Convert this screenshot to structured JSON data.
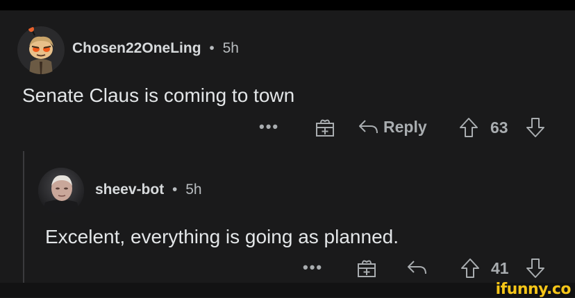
{
  "comment": {
    "username": "Chosen22OneLing",
    "separator": "•",
    "age": "5h",
    "text": "Senate Claus is coming to town",
    "actions": {
      "more_label": "•••",
      "reply_label": "Reply",
      "score": "63"
    }
  },
  "reply": {
    "username": "sheev-bot",
    "separator": "•",
    "age": "5h",
    "text": "Excelent, everything is going as planned.",
    "actions": {
      "more_label": "•••",
      "score": "41"
    }
  },
  "watermark": "ifunny.co",
  "icons": [
    "snoo-avatar-icon",
    "sheev-avatar-icon",
    "more-icon",
    "gift-icon",
    "reply-icon",
    "upvote-icon",
    "downvote-icon"
  ],
  "colors": {
    "background": "#1a1a1b",
    "text": "#d7dadc",
    "muted": "#a9adb0",
    "watermark": "#f5c518"
  }
}
